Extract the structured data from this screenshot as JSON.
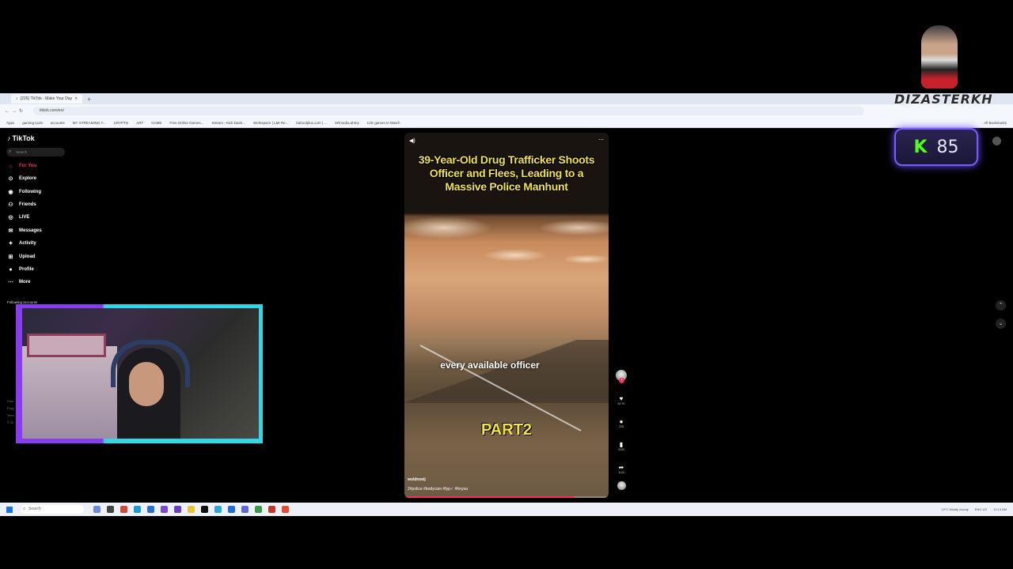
{
  "browser": {
    "tab_title": "(226) TikTok - Make Your Day",
    "url": "tiktok.com/en/",
    "bookmarks": [
      "Apps",
      "gaming tools",
      "accounts",
      "MY STREAMING T...",
      "CRYPTO",
      "ART",
      "GAME",
      "Free Online Games...",
      "Stream - Kick Dash...",
      "Workspace | LMI Re...",
      "kahoolplus.com | ...",
      "SRmedia.ahmy",
      "LVE games to Watch"
    ],
    "bookmarks_right": "All Bookmarks"
  },
  "sidebar": {
    "logo": "TikTok",
    "search_placeholder": "Search",
    "items": [
      {
        "label": "For You",
        "icon": "home-icon",
        "glyph": "⌂"
      },
      {
        "label": "Explore",
        "icon": "compass-icon",
        "glyph": "⊙"
      },
      {
        "label": "Following",
        "icon": "following-icon",
        "glyph": "◉"
      },
      {
        "label": "Friends",
        "icon": "friends-icon",
        "glyph": "⚇"
      },
      {
        "label": "LIVE",
        "icon": "live-icon",
        "glyph": "◎"
      },
      {
        "label": "Messages",
        "icon": "messages-icon",
        "glyph": "✉"
      },
      {
        "label": "Activity",
        "icon": "activity-icon",
        "glyph": "✦"
      },
      {
        "label": "Upload",
        "icon": "upload-icon",
        "glyph": "⊞"
      },
      {
        "label": "Profile",
        "icon": "profile-icon",
        "glyph": "●"
      },
      {
        "label": "More",
        "icon": "more-icon",
        "glyph": "⋯"
      }
    ],
    "following_title": "Following accounts",
    "footer": [
      "Com",
      "Prog",
      "Term",
      "© 20"
    ]
  },
  "video": {
    "title": "39-Year-Old Drug Trafficker Shoots Officer and Flees, Leading to a Massive Police Manhunt",
    "caption": "every available officer",
    "part": "PART2",
    "author": "woldnxeij",
    "tags": "2#police #bodycam #fyp✓ #foryou",
    "progress": 0.83
  },
  "actions": {
    "likes": "26.7K",
    "comments": "226",
    "saves": "2153",
    "shares": "1143"
  },
  "topright": {
    "label": "p"
  },
  "overlay": {
    "brand": "DIZASTERKH",
    "kick_letter": "K",
    "kick_count": "85"
  },
  "taskbar": {
    "search_placeholder": "Search",
    "tray_weather": "19°C Mostly cloudy",
    "tray_lang": "ENG US",
    "tray_time": "12:13 AM"
  },
  "colors": {
    "accent": "#fe2c55",
    "caption_yellow": "#f3e34a",
    "kick_green": "#53fc18"
  }
}
